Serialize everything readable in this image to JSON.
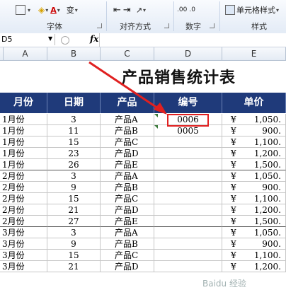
{
  "ribbon": {
    "font_label": "字体",
    "align_label": "对齐方式",
    "number_label": "数字",
    "style_label": "样式",
    "cell_style_btn": "单元格样式",
    "font_color": "A",
    "phonetic": "变"
  },
  "formula_bar": {
    "name_box": "D5",
    "fx": "fx"
  },
  "columns": [
    "A",
    "B",
    "C",
    "D",
    "E"
  ],
  "title": "产品销售统计表",
  "headers": [
    "月份",
    "日期",
    "产品",
    "编号",
    "单价"
  ],
  "rows": [
    [
      "1月份",
      "3",
      "产品A",
      "0006",
      "¥",
      "1,050."
    ],
    [
      "1月份",
      "11",
      "产品B",
      "0005",
      "¥",
      "900."
    ],
    [
      "1月份",
      "15",
      "产品C",
      "",
      "¥",
      "1,100."
    ],
    [
      "1月份",
      "23",
      "产品D",
      "",
      "¥",
      "1,200."
    ],
    [
      "1月份",
      "26",
      "产品E",
      "",
      "¥",
      "1,500."
    ],
    [
      "2月份",
      "3",
      "产品A",
      "",
      "¥",
      "1,050."
    ],
    [
      "2月份",
      "9",
      "产品B",
      "",
      "¥",
      "900."
    ],
    [
      "2月份",
      "15",
      "产品C",
      "",
      "¥",
      "1,100."
    ],
    [
      "2月份",
      "21",
      "产品D",
      "",
      "¥",
      "1,200."
    ],
    [
      "2月份",
      "27",
      "产品E",
      "",
      "¥",
      "1,500."
    ],
    [
      "3月份",
      "3",
      "产品A",
      "",
      "¥",
      "1,050."
    ],
    [
      "3月份",
      "9",
      "产品B",
      "",
      "¥",
      "900."
    ],
    [
      "3月份",
      "15",
      "产品C",
      "",
      "¥",
      "1,100."
    ],
    [
      "3月份",
      "21",
      "产品D",
      "",
      "¥",
      "1,200."
    ]
  ],
  "watermark": "Baidu 经验",
  "colors": {
    "header_bg": "#1f3a7a",
    "highlight": "#e02020",
    "arrow": "#e02020"
  }
}
